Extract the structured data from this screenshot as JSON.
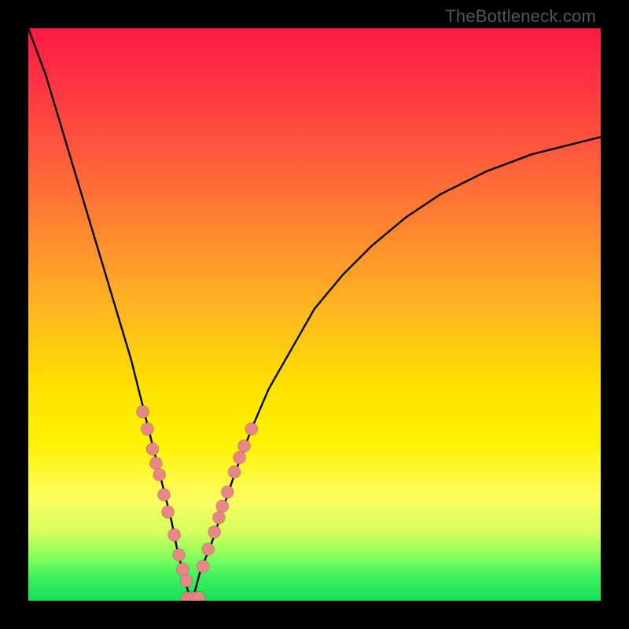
{
  "watermark": "TheBottleneck.com",
  "chart_data": {
    "type": "line",
    "title": "",
    "xlabel": "",
    "ylabel": "",
    "xlim": [
      0,
      100
    ],
    "ylim": [
      0,
      100
    ],
    "grid": false,
    "legend": null,
    "curve": {
      "x": [
        0,
        3,
        6,
        9,
        12,
        15,
        18,
        20,
        22,
        23.5,
        25,
        26,
        27,
        27.8,
        28.5,
        29.2,
        30,
        32,
        34,
        36,
        39,
        42,
        46,
        50,
        55,
        60,
        66,
        72,
        80,
        88,
        96,
        100
      ],
      "y_pct": [
        100,
        92,
        82,
        72,
        62,
        52,
        42,
        34,
        26,
        20,
        14,
        9,
        5,
        2,
        0,
        2,
        5,
        10,
        16,
        22,
        30,
        37,
        44,
        51,
        57,
        62,
        67,
        71,
        75,
        78,
        80,
        81
      ],
      "note": "y_pct is percent of plot-height measured from the bottom (0 = bottom green band, 100 = top red)"
    },
    "markers_left": {
      "x": [
        20.0,
        20.8,
        21.7,
        22.3,
        22.9,
        23.7,
        24.4,
        25.5,
        26.3,
        27.0,
        27.6
      ],
      "y_pct": [
        33.0,
        30.0,
        26.5,
        24.0,
        22.0,
        18.5,
        15.5,
        11.5,
        8.0,
        5.5,
        3.5
      ]
    },
    "markers_right": {
      "x": [
        30.5,
        31.4,
        32.5,
        33.3,
        33.9,
        34.8,
        36.0,
        36.9,
        37.7,
        39.0
      ],
      "y_pct": [
        6.0,
        9.0,
        12.0,
        14.5,
        16.5,
        19.0,
        22.5,
        25.0,
        27.0,
        30.0
      ]
    },
    "markers_bottom": {
      "x": [
        27.8,
        28.3,
        28.8,
        29.3,
        29.8
      ],
      "y_pct": [
        0.5,
        0.5,
        0.5,
        0.5,
        0.5
      ]
    },
    "marker_radius_px": 8
  }
}
